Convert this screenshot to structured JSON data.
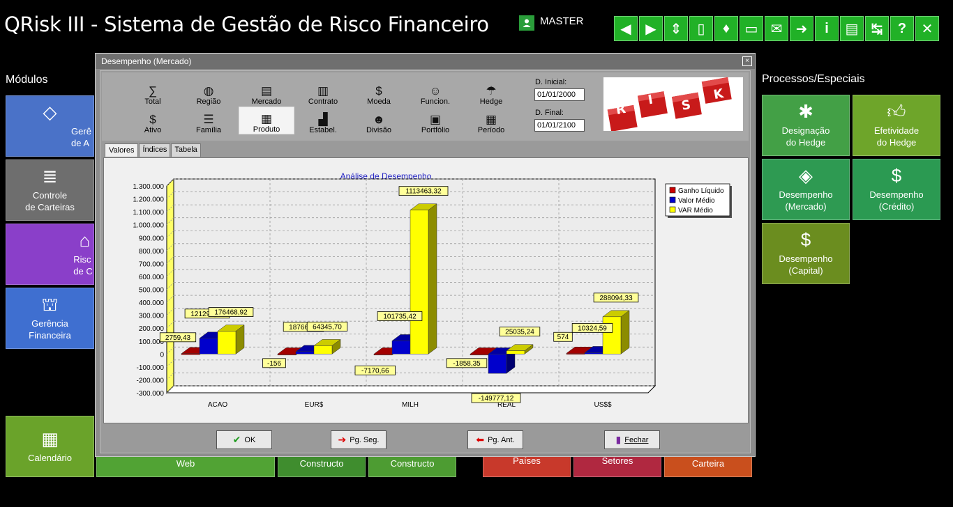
{
  "app": {
    "title": "QRisk III - Sistema de Gestão de Risco Financeiro",
    "user": "MASTER"
  },
  "topbar": {
    "buttons": [
      "◀",
      "▶",
      "⇕",
      "▯",
      "♦",
      "▭",
      "✉",
      "➜",
      "i",
      "▤",
      "↹",
      "?",
      "✕"
    ]
  },
  "modules": {
    "label": "Módulos",
    "tiles": [
      {
        "label": "Gerê\nde A",
        "color": "#4a72c8"
      },
      {
        "label": "Controle\nde Carteiras",
        "color": "#6e6e6e"
      },
      {
        "label": "Risc\nde C",
        "color": "#8a3fc9"
      },
      {
        "label": "Gerência\nFinanceira",
        "color": "#3f6fd0"
      },
      {
        "label": "Calendário",
        "color": "#6aa32a"
      }
    ],
    "bottom_tiles": [
      {
        "label": "Web",
        "color": "#51a334"
      },
      {
        "label": "Constructo",
        "color": "#3f8d2e"
      },
      {
        "label": "Constructo",
        "color": "#4d9c32"
      },
      {
        "label": "Países",
        "color": "#c8392b"
      },
      {
        "label": "Setores",
        "color": "#b02840"
      },
      {
        "label": "Carteira",
        "color": "#c94f1d"
      }
    ]
  },
  "processes": {
    "label": "Processos/Especiais",
    "tiles": [
      {
        "label": "Designação\ndo Hedge",
        "color": "#43a046"
      },
      {
        "label": "Efetividade\ndo Hedge",
        "color": "#6ea52a"
      },
      {
        "label": "Desempenho\n(Mercado)",
        "color": "#2e9a52"
      },
      {
        "label": "Desempenho\n(Crédito)",
        "color": "#2b9a52"
      },
      {
        "label": "Desempenho\n(Capital)",
        "color": "#6b8d1f"
      }
    ]
  },
  "dialog": {
    "title": "Desempenho (Mercado)",
    "close": "×",
    "tools_row1": [
      {
        "label": "Total",
        "icon": "∑"
      },
      {
        "label": "Região",
        "icon": "◍"
      },
      {
        "label": "Mercado",
        "icon": "▤"
      },
      {
        "label": "Contrato",
        "icon": "▥"
      },
      {
        "label": "Moeda",
        "icon": "$"
      },
      {
        "label": "Funcion.",
        "icon": "☺"
      },
      {
        "label": "Hedge",
        "icon": "☂"
      }
    ],
    "tools_row2": [
      {
        "label": "Ativo",
        "icon": "$"
      },
      {
        "label": "Família",
        "icon": "☰"
      },
      {
        "label": "Produto",
        "icon": "▦"
      },
      {
        "label": "Estabel.",
        "icon": "▟"
      },
      {
        "label": "Divisão",
        "icon": "☻"
      },
      {
        "label": "Portfólio",
        "icon": "▣"
      },
      {
        "label": "Período",
        "icon": "▦"
      }
    ],
    "date_start_label": "D. Inicial:",
    "date_start": "01/01/2000",
    "date_end_label": "D. Final:",
    "date_end": "01/01/2100",
    "risk_letters": "RISK",
    "tabs": [
      "Valores",
      "Índices",
      "Tabela"
    ],
    "buttons": {
      "ok": "OK",
      "next": "Pg. Seg.",
      "prev": "Pg. Ant.",
      "close": "Fechar"
    }
  },
  "chart_data": {
    "type": "bar",
    "title": "Análise de Desempenho",
    "categories": [
      "ACAO",
      "EUR$",
      "MILH",
      "REAL",
      "US$$"
    ],
    "series": [
      {
        "name": "Ganho Líquido",
        "color": "#cc0000",
        "values": [
          2759.43,
          -1564,
          -7170.66,
          -1858.35,
          5740
        ]
      },
      {
        "name": "Valor Médio",
        "color": "#0000cc",
        "values": [
          121296.39,
          18766.26,
          101735.42,
          -149777.12,
          10324.59
        ]
      },
      {
        "name": "VAR Médio",
        "color": "#ffff00",
        "values": [
          176468.92,
          64345.7,
          1113463.32,
          25035.24,
          288094.33
        ]
      }
    ],
    "labels": [
      [
        "2759,43",
        "121296,39",
        "176468,92"
      ],
      [
        "-156",
        "18766,26",
        "64345,70"
      ],
      [
        "-7170,66",
        "101735,42",
        "1113463,32"
      ],
      [
        "-1858,35",
        "-149777,12",
        "25035,24"
      ],
      [
        "574",
        "10324,59",
        "288094,33"
      ]
    ],
    "yticks": [
      "1.300.000",
      "1.200.000",
      "1.100.000",
      "1.000.000",
      "900.000",
      "800.000",
      "700.000",
      "600.000",
      "500.000",
      "400.000",
      "300.000",
      "200.000",
      "100.000",
      "0",
      "-100.000",
      "-200.000",
      "-300.000"
    ],
    "ylim": [
      -300000,
      1300000
    ],
    "grid": true,
    "legend": "top-right"
  }
}
